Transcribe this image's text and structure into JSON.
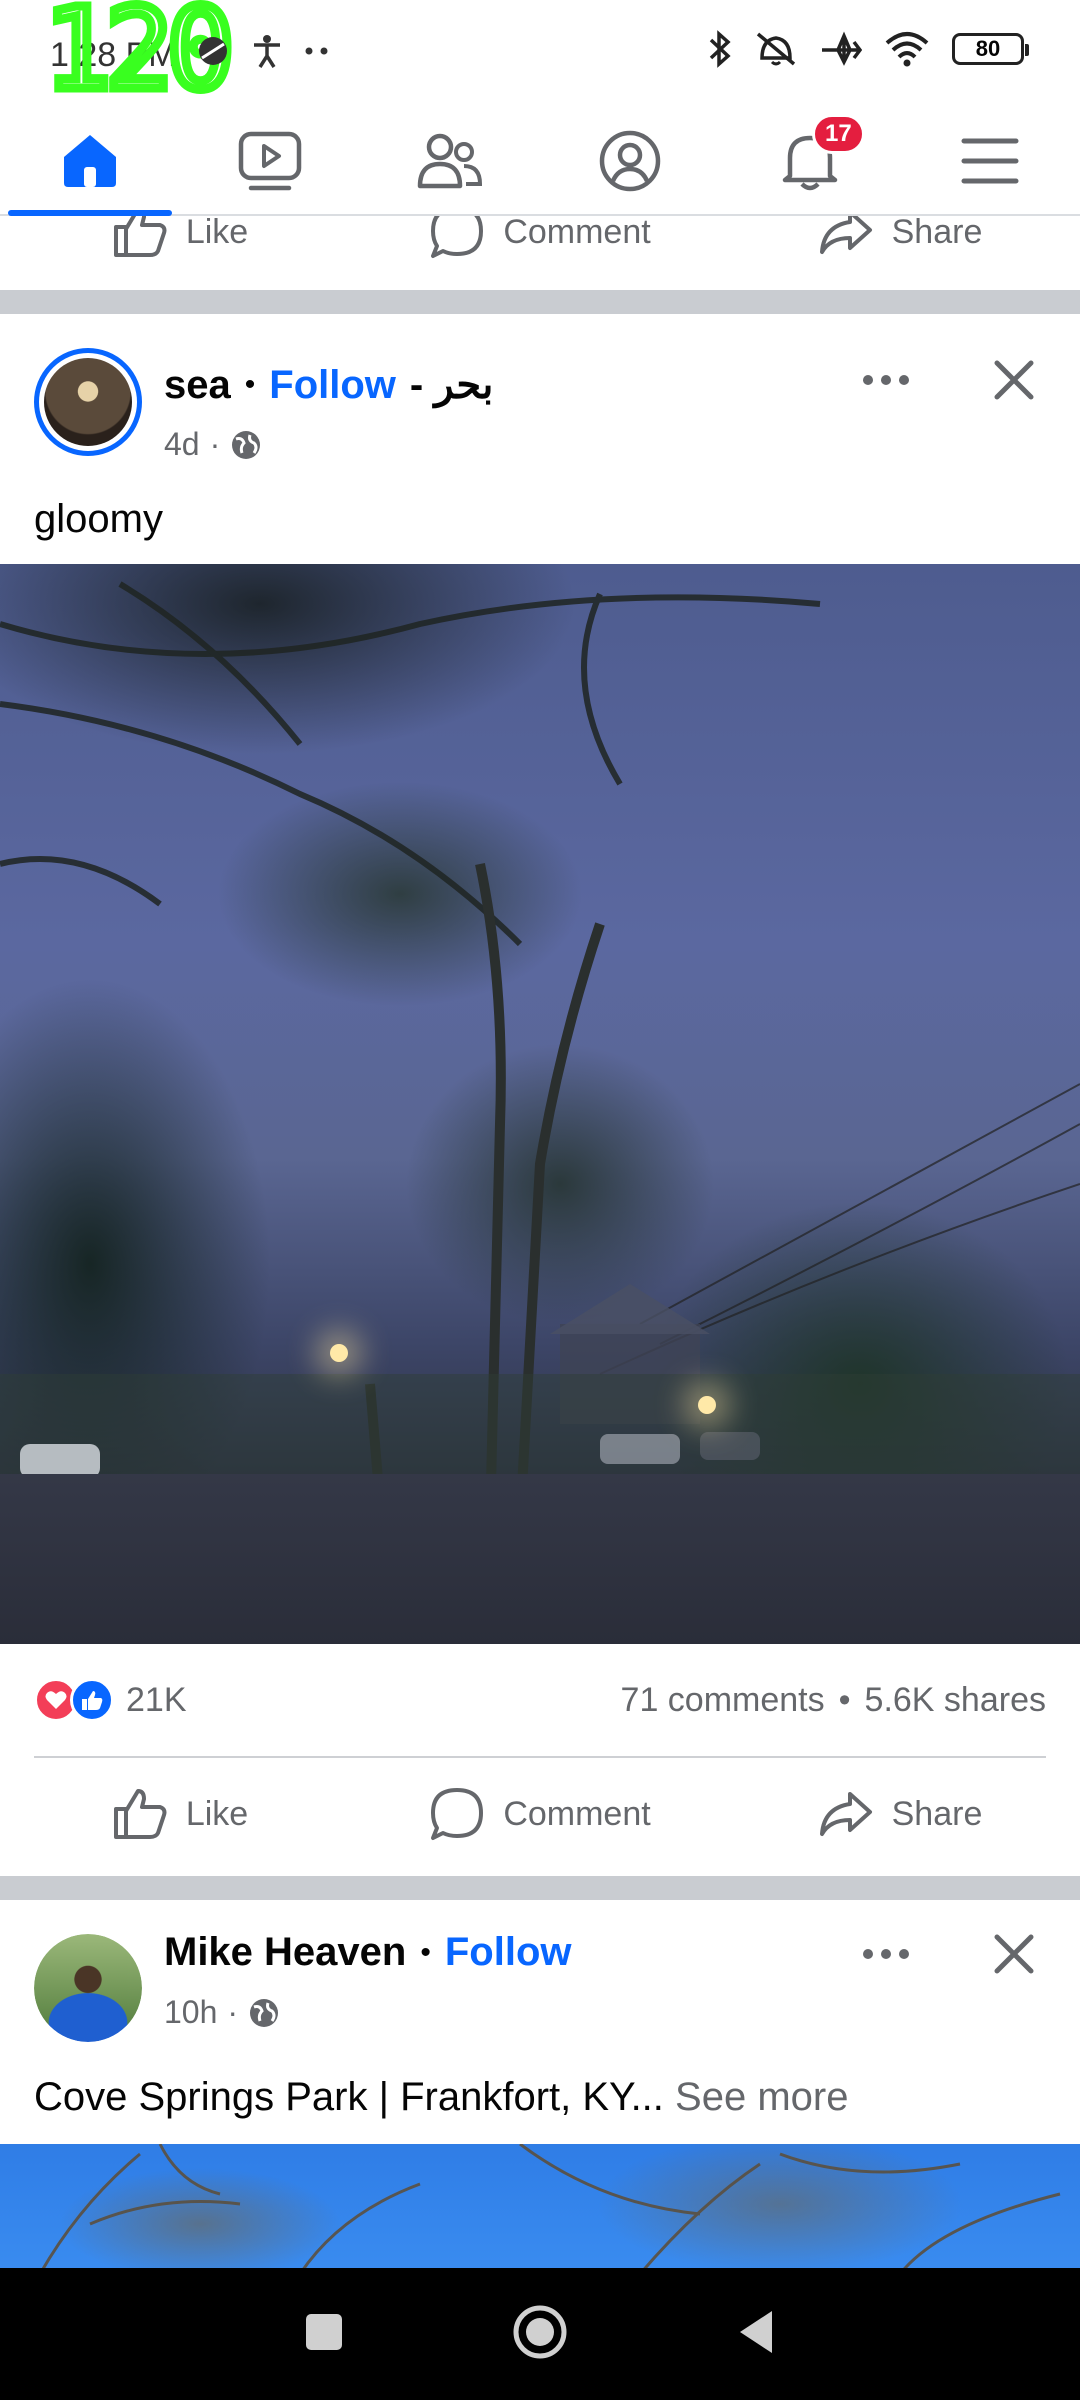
{
  "status_bar": {
    "time": "1:28 PM",
    "fps_overlay": "120",
    "battery": "80"
  },
  "nav": {
    "tabs": [
      {
        "name": "home",
        "icon": "home-icon",
        "active": true
      },
      {
        "name": "video",
        "icon": "video-icon",
        "active": false
      },
      {
        "name": "friends",
        "icon": "friends-icon",
        "active": false
      },
      {
        "name": "profile",
        "icon": "profile-icon",
        "active": false
      },
      {
        "name": "notifications",
        "icon": "bell-icon",
        "active": false,
        "badge": "17"
      },
      {
        "name": "menu",
        "icon": "menu-icon",
        "active": false
      }
    ],
    "accent_color": "#0866ff"
  },
  "actions": {
    "like": "Like",
    "comment": "Comment",
    "share": "Share"
  },
  "posts": [
    {
      "author": "sea",
      "separator": "•",
      "follow": "Follow",
      "suffix": "- بحر",
      "time": "4d",
      "text": "gloomy",
      "reactions": "21K",
      "comments": "71 comments",
      "stat_sep": "•",
      "shares": "5.6K shares"
    },
    {
      "author": "Mike Heaven",
      "separator": "•",
      "follow": "Follow",
      "time": "10h",
      "text": "Cove Springs Park | Frankfort, KY...",
      "see_more": "See more"
    }
  ]
}
